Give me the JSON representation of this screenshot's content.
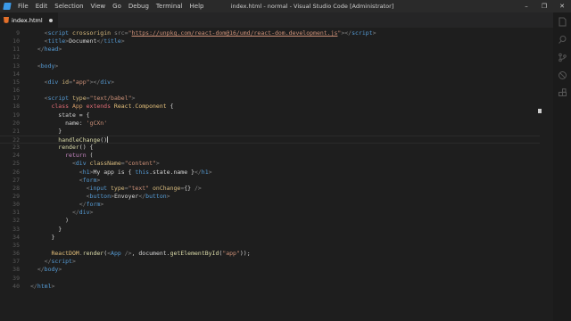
{
  "titlebar": {
    "menu": [
      "File",
      "Edit",
      "Selection",
      "View",
      "Go",
      "Debug",
      "Terminal",
      "Help"
    ],
    "title": "index.html - normal - Visual Studio Code [Administrator]",
    "controls": [
      "–",
      "❐",
      "✕"
    ]
  },
  "tabs": [
    {
      "label": "index.html",
      "dirty": true,
      "icon": "html-file-icon"
    }
  ],
  "editor": {
    "current_line": 22,
    "lines": [
      {
        "n": "9",
        "tokens": [
          [
            "pun",
            "    <"
          ],
          [
            "tag",
            "script"
          ],
          [
            "attr",
            " crossorigin"
          ],
          [
            "pun",
            " src="
          ],
          [
            "str",
            "\""
          ],
          [
            "url",
            "https://unpkg.com/react-dom@16/umd/react-dom.development.js"
          ],
          [
            "str",
            "\""
          ],
          [
            "pun",
            "></"
          ],
          [
            "tag",
            "script"
          ],
          [
            "pun",
            ">"
          ]
        ]
      },
      {
        "n": "10",
        "tokens": [
          [
            "pun",
            "    <"
          ],
          [
            "tag",
            "title"
          ],
          [
            "pun",
            ">"
          ],
          [
            "txt",
            "Document"
          ],
          [
            "pun",
            "</"
          ],
          [
            "tag",
            "title"
          ],
          [
            "pun",
            ">"
          ]
        ]
      },
      {
        "n": "11",
        "tokens": [
          [
            "pun",
            "  </"
          ],
          [
            "tag",
            "head"
          ],
          [
            "pun",
            ">"
          ]
        ]
      },
      {
        "n": "12",
        "tokens": []
      },
      {
        "n": "13",
        "tokens": [
          [
            "pun",
            "  <"
          ],
          [
            "tag",
            "body"
          ],
          [
            "pun",
            ">"
          ]
        ]
      },
      {
        "n": "14",
        "tokens": []
      },
      {
        "n": "15",
        "tokens": [
          [
            "pun",
            "    <"
          ],
          [
            "tag",
            "div"
          ],
          [
            "attr",
            " id"
          ],
          [
            "pun",
            "="
          ],
          [
            "str",
            "\"app\""
          ],
          [
            "pun",
            "></"
          ],
          [
            "tag",
            "div"
          ],
          [
            "pun",
            ">"
          ]
        ]
      },
      {
        "n": "16",
        "tokens": []
      },
      {
        "n": "17",
        "tokens": [
          [
            "pun",
            "    <"
          ],
          [
            "tag",
            "script"
          ],
          [
            "attr",
            " type"
          ],
          [
            "pun",
            "="
          ],
          [
            "str",
            "\"text/babel\""
          ],
          [
            "pun",
            ">"
          ]
        ]
      },
      {
        "n": "18",
        "tokens": [
          [
            "kw2",
            "      class"
          ],
          [
            "cls",
            " App"
          ],
          [
            "kw2",
            " extends"
          ],
          [
            "var",
            " React"
          ],
          [
            "pun",
            "."
          ],
          [
            "var",
            "Component"
          ],
          [
            "txt",
            " {"
          ]
        ]
      },
      {
        "n": "19",
        "tokens": [
          [
            "prop",
            "        state"
          ],
          [
            "txt",
            " = {"
          ]
        ]
      },
      {
        "n": "20",
        "tokens": [
          [
            "prop",
            "          name"
          ],
          [
            "txt",
            ": "
          ],
          [
            "str",
            "'gCXn'"
          ]
        ]
      },
      {
        "n": "21",
        "tokens": [
          [
            "txt",
            "        }"
          ]
        ]
      },
      {
        "n": "22",
        "tokens": [
          [
            "fn",
            "        handleChange"
          ],
          [
            "txt",
            "()"
          ]
        ],
        "cursor": true
      },
      {
        "n": "23",
        "tokens": [
          [
            "fn",
            "        render"
          ],
          [
            "txt",
            "() {"
          ]
        ]
      },
      {
        "n": "24",
        "tokens": [
          [
            "kw",
            "          return"
          ],
          [
            "txt",
            " ("
          ]
        ]
      },
      {
        "n": "25",
        "tokens": [
          [
            "pun",
            "            <"
          ],
          [
            "tag",
            "div"
          ],
          [
            "attr",
            " className"
          ],
          [
            "pun",
            "="
          ],
          [
            "str",
            "\"content\""
          ],
          [
            "pun",
            ">"
          ]
        ]
      },
      {
        "n": "26",
        "tokens": [
          [
            "pun",
            "              <"
          ],
          [
            "tag",
            "h1"
          ],
          [
            "pun",
            ">"
          ],
          [
            "txt",
            "My app is { "
          ],
          [
            "this",
            "this"
          ],
          [
            "txt",
            ".state.name }"
          ],
          [
            "pun",
            "</"
          ],
          [
            "tag",
            "h1"
          ],
          [
            "pun",
            ">"
          ]
        ]
      },
      {
        "n": "27",
        "tokens": [
          [
            "pun",
            "              <"
          ],
          [
            "tag",
            "form"
          ],
          [
            "pun",
            ">"
          ]
        ]
      },
      {
        "n": "28",
        "tokens": [
          [
            "pun",
            "                <"
          ],
          [
            "tag",
            "input"
          ],
          [
            "attr",
            " type"
          ],
          [
            "pun",
            "="
          ],
          [
            "str",
            "\"text\""
          ],
          [
            "attr",
            " onChange"
          ],
          [
            "pun",
            "="
          ],
          [
            "txt",
            "{}"
          ],
          [
            "pun",
            " />"
          ]
        ]
      },
      {
        "n": "29",
        "tokens": [
          [
            "pun",
            "                <"
          ],
          [
            "tag",
            "button"
          ],
          [
            "pun",
            ">"
          ],
          [
            "txt",
            "Envoyer"
          ],
          [
            "pun",
            "</"
          ],
          [
            "tag",
            "button"
          ],
          [
            "pun",
            ">"
          ]
        ]
      },
      {
        "n": "30",
        "tokens": [
          [
            "pun",
            "              </"
          ],
          [
            "tag",
            "form"
          ],
          [
            "pun",
            ">"
          ]
        ]
      },
      {
        "n": "31",
        "tokens": [
          [
            "pun",
            "            </"
          ],
          [
            "tag",
            "div"
          ],
          [
            "pun",
            ">"
          ]
        ]
      },
      {
        "n": "32",
        "tokens": [
          [
            "txt",
            "          )"
          ]
        ]
      },
      {
        "n": "33",
        "tokens": [
          [
            "txt",
            "        }"
          ]
        ]
      },
      {
        "n": "34",
        "tokens": [
          [
            "txt",
            "      }"
          ]
        ]
      },
      {
        "n": "35",
        "tokens": []
      },
      {
        "n": "36",
        "tokens": [
          [
            "var",
            "      ReactDOM"
          ],
          [
            "pun",
            "."
          ],
          [
            "fn",
            "render"
          ],
          [
            "txt",
            "("
          ],
          [
            "pun",
            "<"
          ],
          [
            "tag",
            "App"
          ],
          [
            "pun",
            " />"
          ],
          [
            "txt",
            ", document."
          ],
          [
            "fn",
            "getElementById"
          ],
          [
            "txt",
            "("
          ],
          [
            "str",
            "\"app\""
          ],
          [
            "txt",
            "));"
          ]
        ]
      },
      {
        "n": "37",
        "tokens": [
          [
            "pun",
            "    </"
          ],
          [
            "tag",
            "script"
          ],
          [
            "pun",
            ">"
          ]
        ]
      },
      {
        "n": "38",
        "tokens": [
          [
            "pun",
            "  </"
          ],
          [
            "tag",
            "body"
          ],
          [
            "pun",
            ">"
          ]
        ]
      },
      {
        "n": "39",
        "tokens": []
      },
      {
        "n": "40",
        "tokens": [
          [
            "pun",
            "</"
          ],
          [
            "tag",
            "html"
          ],
          [
            "pun",
            ">"
          ]
        ]
      }
    ]
  },
  "activitybar": {
    "icons": [
      "files-icon",
      "search-icon",
      "source-control-icon",
      "debug-icon",
      "extensions-icon"
    ]
  },
  "colors": {
    "background": "#1e1e1e",
    "titlebar": "#2a2a2a",
    "accent": "#3b9ae8"
  }
}
